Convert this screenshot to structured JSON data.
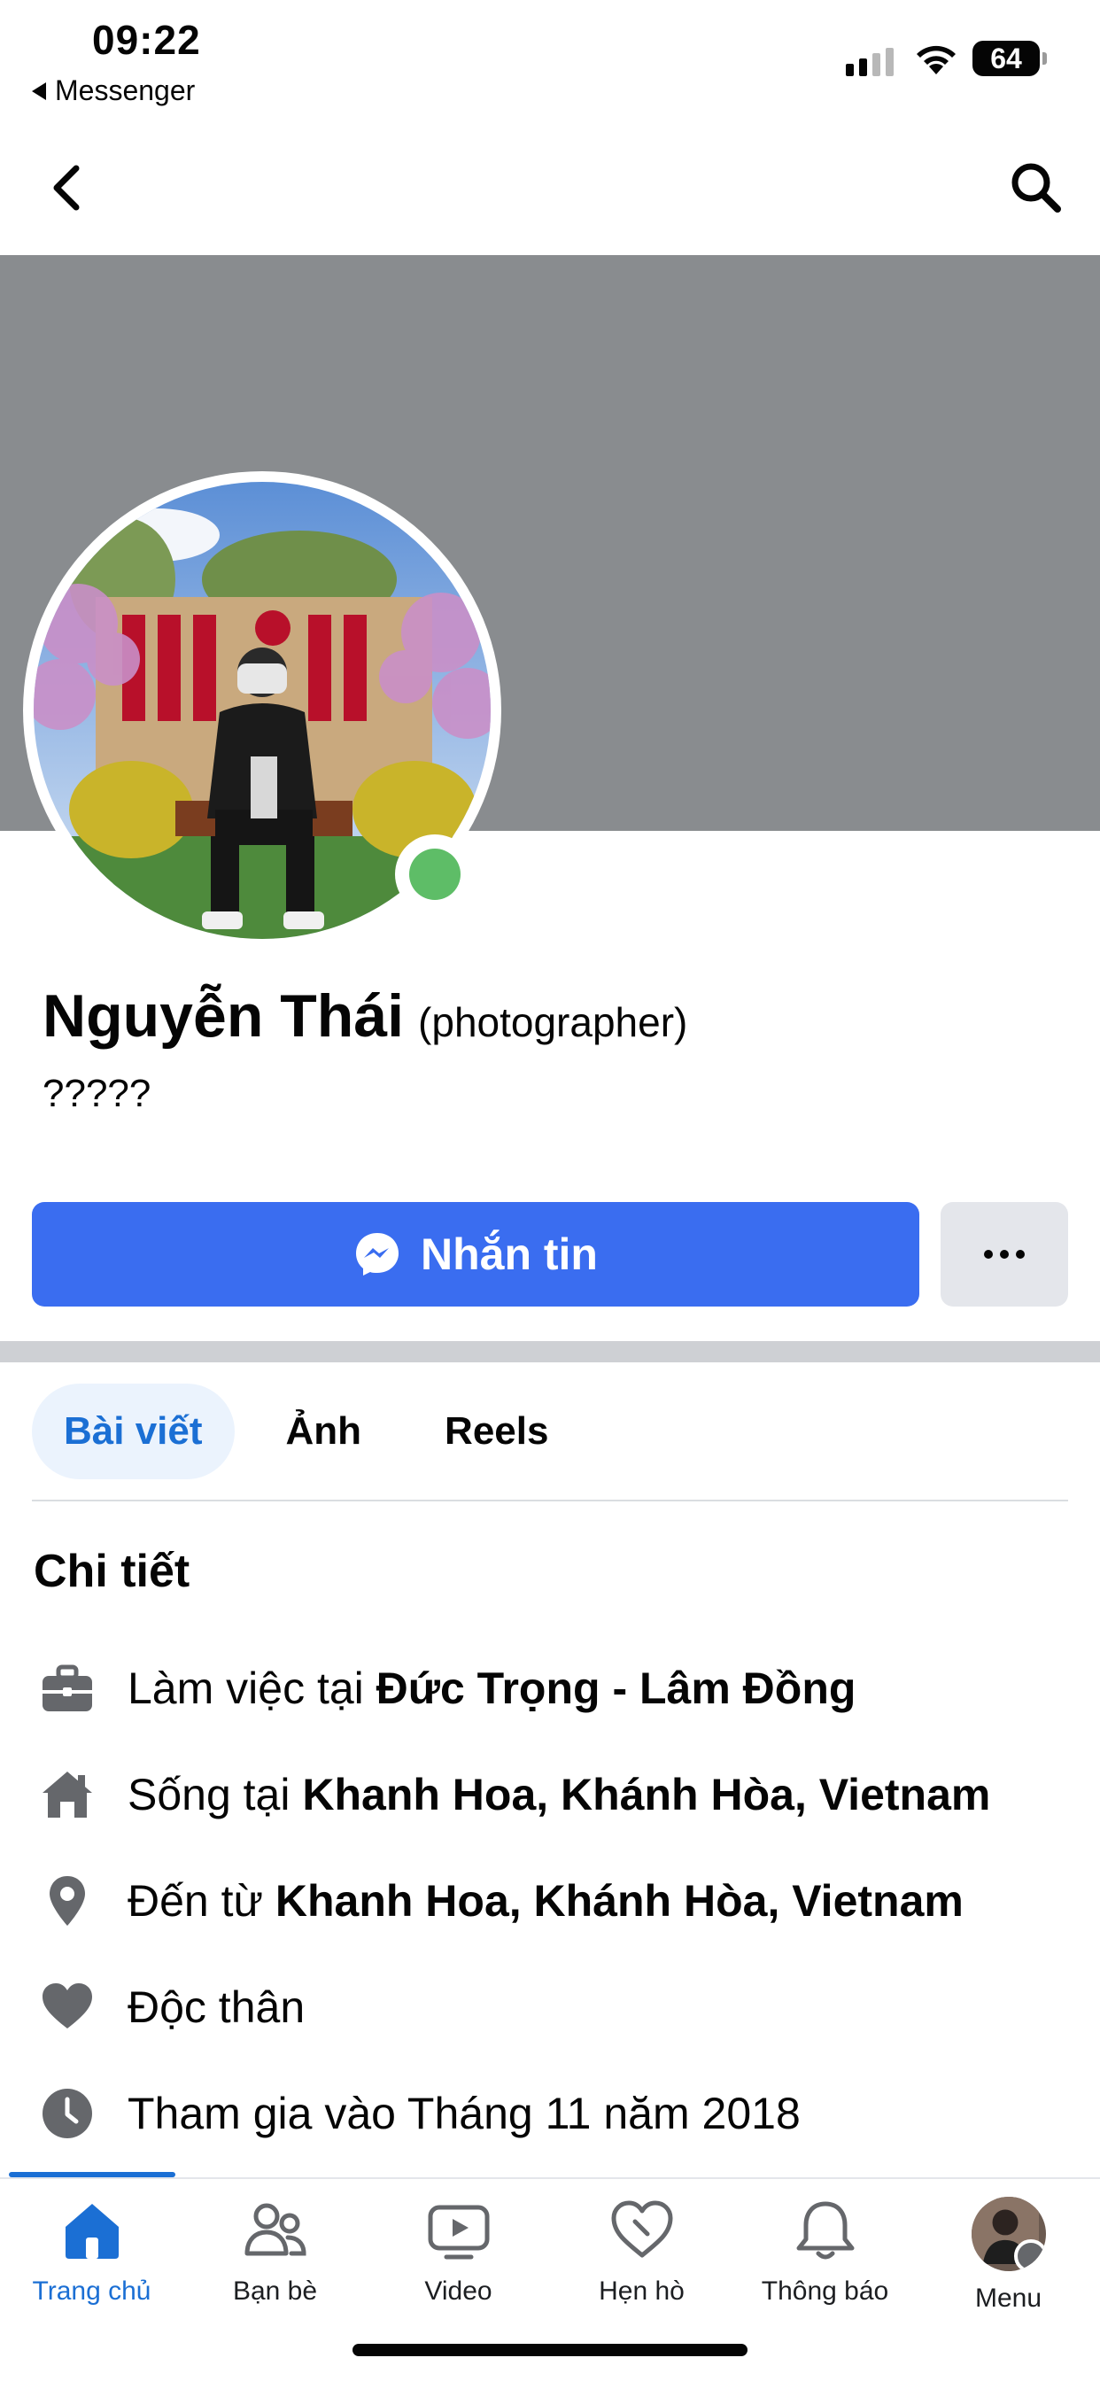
{
  "status_bar": {
    "time": "09:22",
    "back_app": "Messenger",
    "battery": "64"
  },
  "nav": {
    "back_icon": "chevron-left-icon",
    "search_icon": "search-icon"
  },
  "profile": {
    "name": "Nguyễn Thái",
    "nickname": "(photographer)",
    "bio": "?????",
    "online_color": "#5ebd67"
  },
  "actions": {
    "message_label": "Nhắn tin",
    "message_color": "#3a6df0"
  },
  "tabs": [
    {
      "label": "Bài viết",
      "active": true
    },
    {
      "label": "Ảnh",
      "active": false
    },
    {
      "label": "Reels",
      "active": false
    }
  ],
  "details": {
    "title": "Chi tiết",
    "items": [
      {
        "icon": "briefcase-icon",
        "prefix": "Làm việc tại ",
        "bold": "Đức Trọng - Lâm Đồng"
      },
      {
        "icon": "home-icon",
        "prefix": "Sống tại ",
        "bold": "Khanh Hoa, Khánh Hòa, Vietnam"
      },
      {
        "icon": "location-pin-icon",
        "prefix": "Đến từ ",
        "bold": "Khanh Hoa, Khánh Hòa, Vietnam"
      },
      {
        "icon": "heart-icon",
        "prefix": "Độc thân",
        "bold": ""
      },
      {
        "icon": "clock-icon",
        "prefix": "Tham gia vào Tháng 11 năm 2018",
        "bold": ""
      }
    ]
  },
  "bottom_nav": [
    {
      "label": "Trang chủ",
      "icon": "home-icon",
      "active": true
    },
    {
      "label": "Bạn bè",
      "icon": "friends-icon",
      "active": false
    },
    {
      "label": "Video",
      "icon": "video-icon",
      "active": false
    },
    {
      "label": "Hẹn hò",
      "icon": "dating-heart-icon",
      "active": false
    },
    {
      "label": "Thông báo",
      "icon": "bell-icon",
      "active": false
    },
    {
      "label": "Menu",
      "icon": "menu-avatar",
      "active": false
    }
  ],
  "colors": {
    "accent": "#1b6fd4",
    "cover": "#898c8f"
  }
}
